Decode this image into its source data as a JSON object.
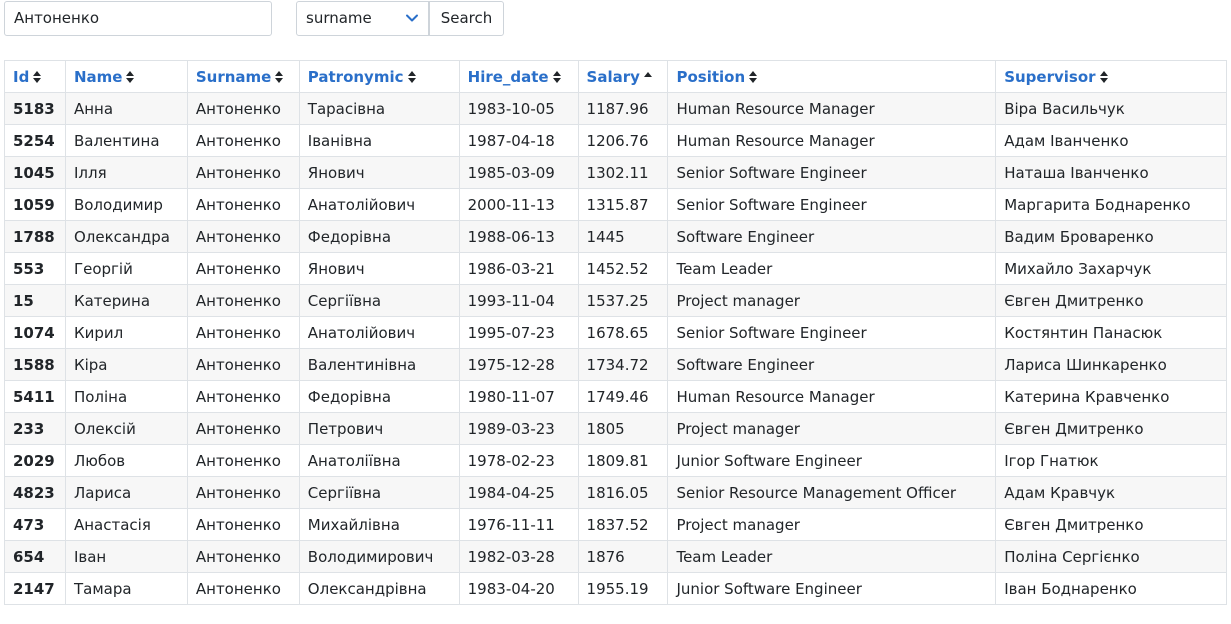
{
  "search": {
    "value": "Антоненко",
    "field_selected": "surname",
    "button_label": "Search"
  },
  "table": {
    "columns": [
      {
        "label": "Id",
        "sort": "both"
      },
      {
        "label": "Name",
        "sort": "both"
      },
      {
        "label": "Surname",
        "sort": "both"
      },
      {
        "label": "Patronymic",
        "sort": "both"
      },
      {
        "label": "Hire_date",
        "sort": "both"
      },
      {
        "label": "Salary",
        "sort": "asc"
      },
      {
        "label": "Position",
        "sort": "both"
      },
      {
        "label": "Supervisor",
        "sort": "both"
      }
    ],
    "rows": [
      [
        "5183",
        "Анна",
        "Антоненко",
        "Тарасівна",
        "1983-10-05",
        "1187.96",
        "Human Resource Manager",
        "Віра Васильчук"
      ],
      [
        "5254",
        "Валентина",
        "Антоненко",
        "Іванівна",
        "1987-04-18",
        "1206.76",
        "Human Resource Manager",
        "Адам Іванченко"
      ],
      [
        "1045",
        "Ілля",
        "Антоненко",
        "Янович",
        "1985-03-09",
        "1302.11",
        "Senior Software Engineer",
        "Наташа Іванченко"
      ],
      [
        "1059",
        "Володимир",
        "Антоненко",
        "Анатолійович",
        "2000-11-13",
        "1315.87",
        "Senior Software Engineer",
        "Маргарита Боднаренко"
      ],
      [
        "1788",
        "Олександра",
        "Антоненко",
        "Федорівна",
        "1988-06-13",
        "1445",
        "Software Engineer",
        "Вадим Броваренко"
      ],
      [
        "553",
        "Георгій",
        "Антоненко",
        "Янович",
        "1986-03-21",
        "1452.52",
        "Team Leader",
        "Михайло Захарчук"
      ],
      [
        "15",
        "Катерина",
        "Антоненко",
        "Сергіївна",
        "1993-11-04",
        "1537.25",
        "Project manager",
        "Євген Дмитренко"
      ],
      [
        "1074",
        "Кирил",
        "Антоненко",
        "Анатолійович",
        "1995-07-23",
        "1678.65",
        "Senior Software Engineer",
        "Костянтин Панасюк"
      ],
      [
        "1588",
        "Кіра",
        "Антоненко",
        "Валентинівна",
        "1975-12-28",
        "1734.72",
        "Software Engineer",
        "Лариса Шинкаренко"
      ],
      [
        "5411",
        "Поліна",
        "Антоненко",
        "Федорівна",
        "1980-11-07",
        "1749.46",
        "Human Resource Manager",
        "Катерина Кравченко"
      ],
      [
        "233",
        "Олексій",
        "Антоненко",
        "Петрович",
        "1989-03-23",
        "1805",
        "Project manager",
        "Євген Дмитренко"
      ],
      [
        "2029",
        "Любов",
        "Антоненко",
        "Анатоліївна",
        "1978-02-23",
        "1809.81",
        "Junior Software Engineer",
        "Ігор Гнатюк"
      ],
      [
        "4823",
        "Лариса",
        "Антоненко",
        "Сергіївна",
        "1984-04-25",
        "1816.05",
        "Senior Resource Management Officer",
        "Адам Кравчук"
      ],
      [
        "473",
        "Анастасія",
        "Антоненко",
        "Михайлівна",
        "1976-11-11",
        "1837.52",
        "Project manager",
        "Євген Дмитренко"
      ],
      [
        "654",
        "Іван",
        "Антоненко",
        "Володимирович",
        "1982-03-28",
        "1876",
        "Team Leader",
        "Поліна Сергієнко"
      ],
      [
        "2147",
        "Тамара",
        "Антоненко",
        "Олександрівна",
        "1983-04-20",
        "1955.19",
        "Junior Software Engineer",
        "Іван Боднаренко"
      ]
    ]
  },
  "colors": {
    "link": "#2a6fc9",
    "border": "#dee2e6",
    "stripe": "#f7f7f7"
  },
  "icons": {
    "dropdown": "chevron-down-icon",
    "sort_both": "sort-both-icon",
    "sort_asc": "sort-asc-icon"
  }
}
